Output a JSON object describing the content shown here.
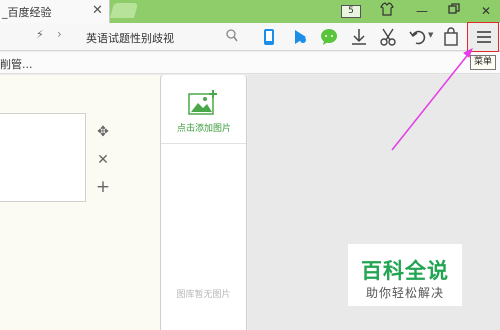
{
  "tabbar": {
    "active_tab_title": "_百度经验",
    "tab_counter": "5"
  },
  "addressbar": {
    "query": "英语试题性别歧视",
    "icons": [
      "flash-icon",
      "chevron-right-icon",
      "search-icon",
      "phone-icon",
      "play-icon",
      "chat-icon",
      "download-icon",
      "scissors-icon",
      "undo-icon",
      "dropdown-arrow-icon",
      "bag-icon",
      "menu-icon"
    ]
  },
  "bookmarks": {
    "first_item": "削管..."
  },
  "menu": {
    "tooltip": "菜单"
  },
  "editor": {
    "add_image_label": "点击添加图片",
    "empty_gallery_text": "图库暂无图片",
    "controls": [
      "move-icon",
      "close-icon",
      "plus-icon"
    ]
  },
  "watermark": {
    "title": "百科全说",
    "subtitle": "助你轻松解决"
  },
  "colors": {
    "tab_green": "#8fcd6a",
    "accent_green": "#22a552",
    "highlight_red": "#e12a2a",
    "annotation_magenta": "#e43ce6",
    "icon_blue": "#1a8ee8"
  }
}
